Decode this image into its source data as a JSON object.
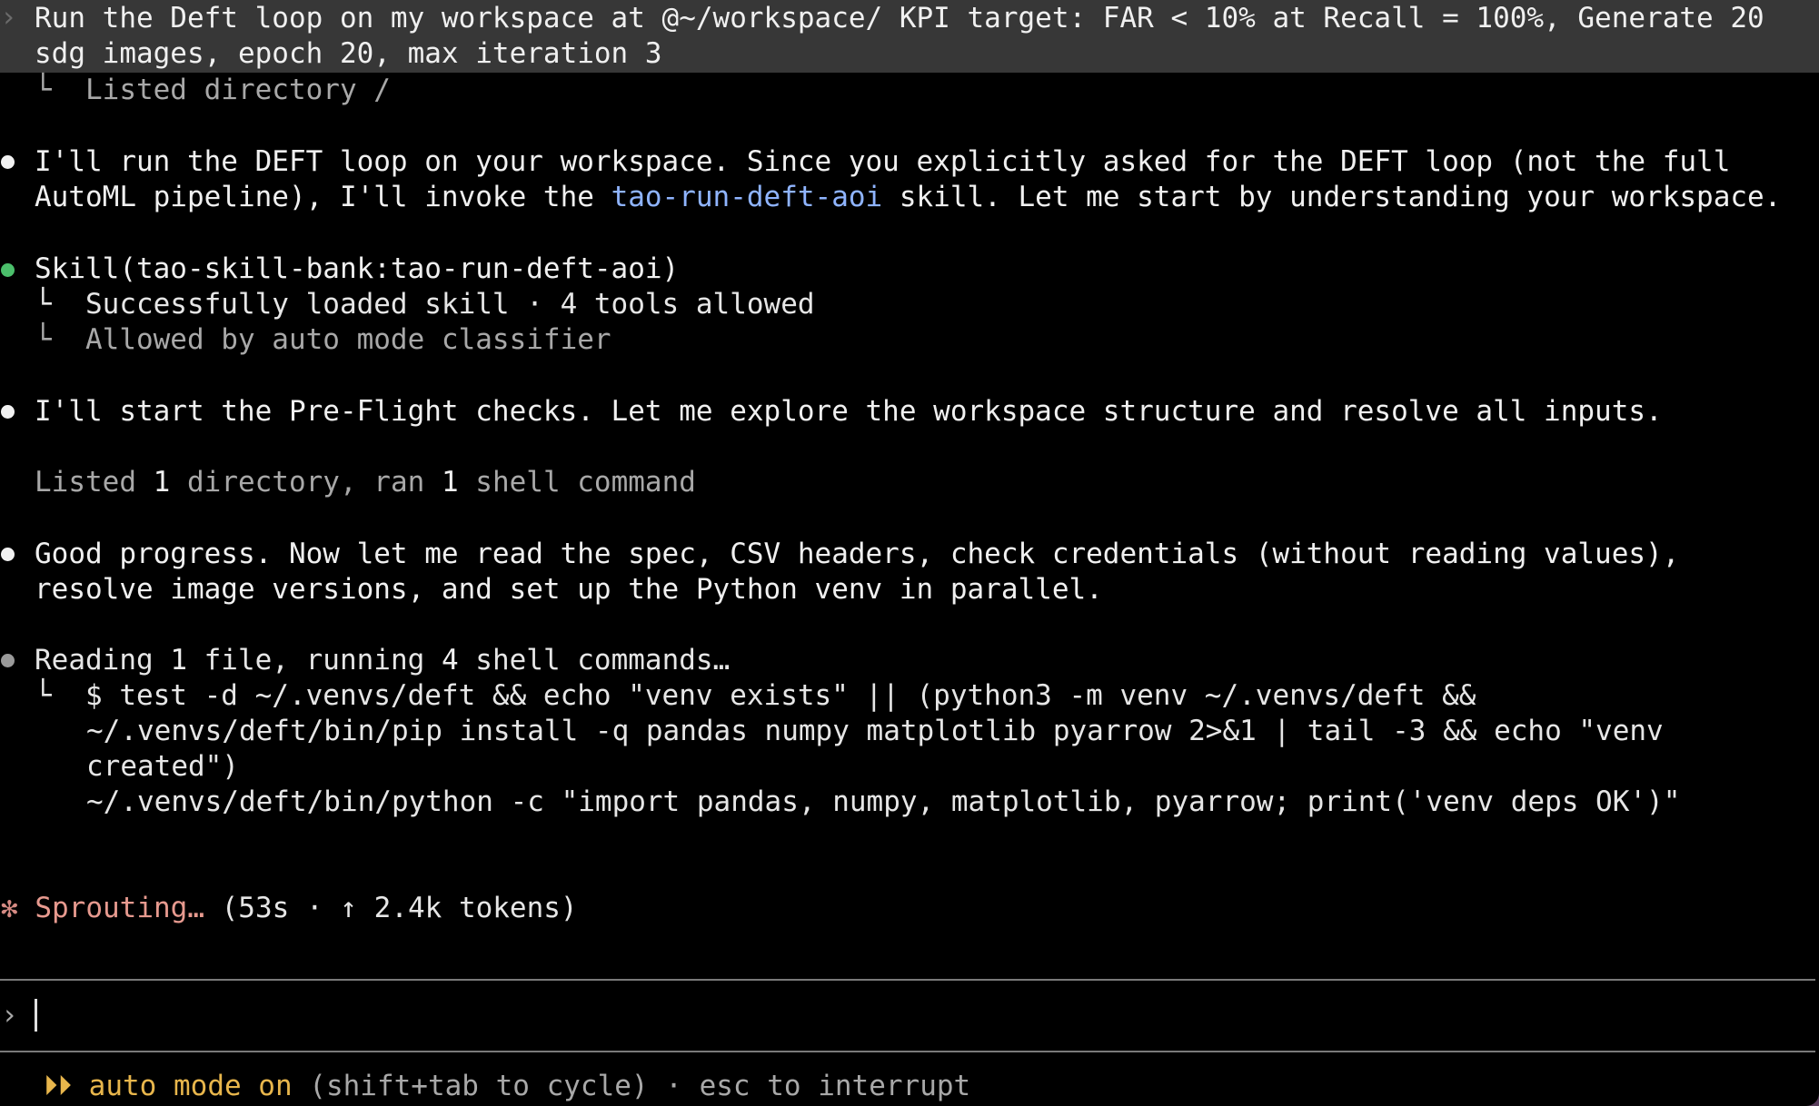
{
  "user_prompt": {
    "line1": "Run the Deft loop on my workspace at @~/workspace/ KPI target: FAR < 10% at Recall = 100%, Generate 20",
    "line2": "sdg images, epoch 20, max iteration 3",
    "caret": "›"
  },
  "transcript": {
    "listed_root": "└  Listed directory /",
    "msg1_line1": "I'll run the DEFT loop on your workspace. Since you explicitly asked for the DEFT loop (not the full",
    "msg1_line2_pre": "AutoML pipeline), I'll invoke the ",
    "msg1_link": "tao-run-deft-aoi",
    "msg1_line2_post": " skill. Let me start by understanding your workspace.",
    "skill_call": "Skill(tao-skill-bank:tao-run-deft-aoi)",
    "skill_loaded": "└  Successfully loaded skill · 4 tools allowed",
    "skill_allowed": "└  Allowed by auto mode classifier",
    "msg2": "I'll start the Pre-Flight checks. Let me explore the workspace structure and resolve all inputs.",
    "summary_pre": "Listed ",
    "summary_n1": "1",
    "summary_mid": " directory, ran ",
    "summary_n2": "1",
    "summary_post": " shell command",
    "msg3_line1": "Good progress. Now let me read the spec, CSV headers, check credentials (without reading values),",
    "msg3_line2": "resolve image versions, and set up the Python venv in parallel.",
    "running_pre": "Reading ",
    "running_n1": "1",
    "running_mid": " file, running ",
    "running_n2": "4",
    "running_post": " shell commands…",
    "cmd_line1": "└  $ test -d ~/.venvs/deft && echo \"venv exists\" || (python3 -m venv ~/.venvs/deft &&",
    "cmd_line2": "~/.venvs/deft/bin/pip install -q pandas numpy matplotlib pyarrow 2>&1 | tail -3 && echo \"venv",
    "cmd_line3": "created\")",
    "cmd_line4": "~/.venvs/deft/bin/python -c \"import pandas, numpy, matplotlib, pyarrow; print('venv deps OK')\""
  },
  "status": {
    "spinner_glyph": "✻",
    "verb": "Sprouting…",
    "detail": " (53s · ↑ 2.4k tokens)"
  },
  "input": {
    "caret": "›",
    "value": ""
  },
  "footer": {
    "arrows": "⏵⏵",
    "mode": "auto mode on",
    "hint": " (shift+tab to cycle) · esc to interrupt"
  },
  "colors": {
    "background": "#000000",
    "prompt_bg": "#373737",
    "link": "#8fb4ff",
    "success_bullet": "#4bbf6b",
    "spinner": "#e79a8f",
    "auto_mode": "#e8b64c"
  }
}
